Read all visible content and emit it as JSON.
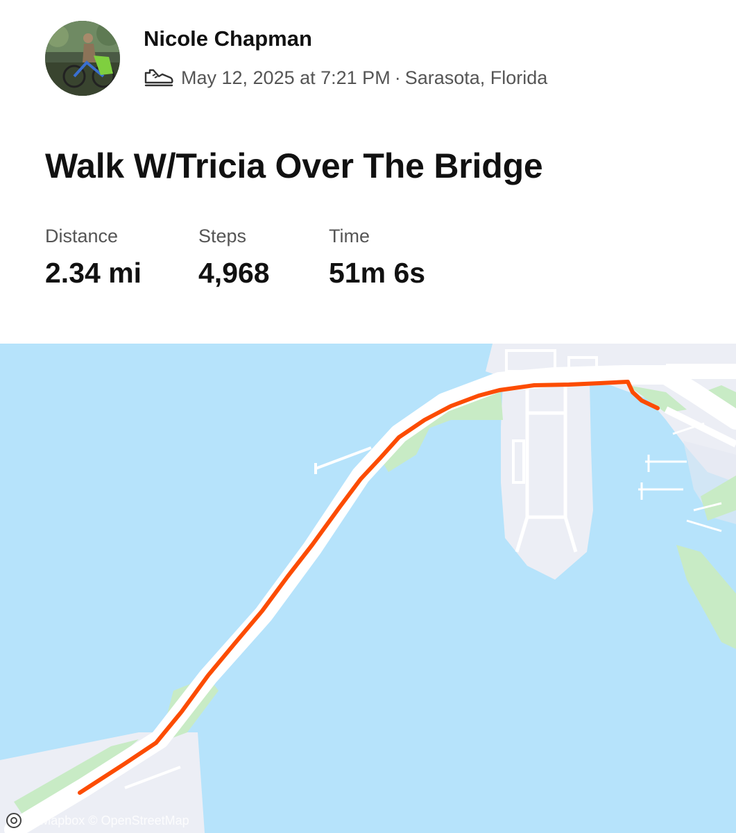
{
  "athlete": {
    "name": "Nicole Chapman",
    "avatar_icon": "athlete-avatar-photo"
  },
  "activity": {
    "type_icon": "walking-shoe-icon",
    "datetime": "May 12, 2025 at 7:21 PM",
    "separator": "·",
    "location": "Sarasota, Florida",
    "title": "Walk W/Tricia Over The Bridge"
  },
  "stats": [
    {
      "label": "Distance",
      "value": "2.34 mi"
    },
    {
      "label": "Steps",
      "value": "4,968"
    },
    {
      "label": "Time",
      "value": "51m 6s"
    }
  ],
  "map": {
    "attribution": "© Mapbox © OpenStreetMap",
    "colors": {
      "water": "#b6e3fb",
      "land": "#eceef5",
      "park": "#c8ebc5",
      "road": "#ffffff",
      "route": "#fc4c02"
    }
  }
}
